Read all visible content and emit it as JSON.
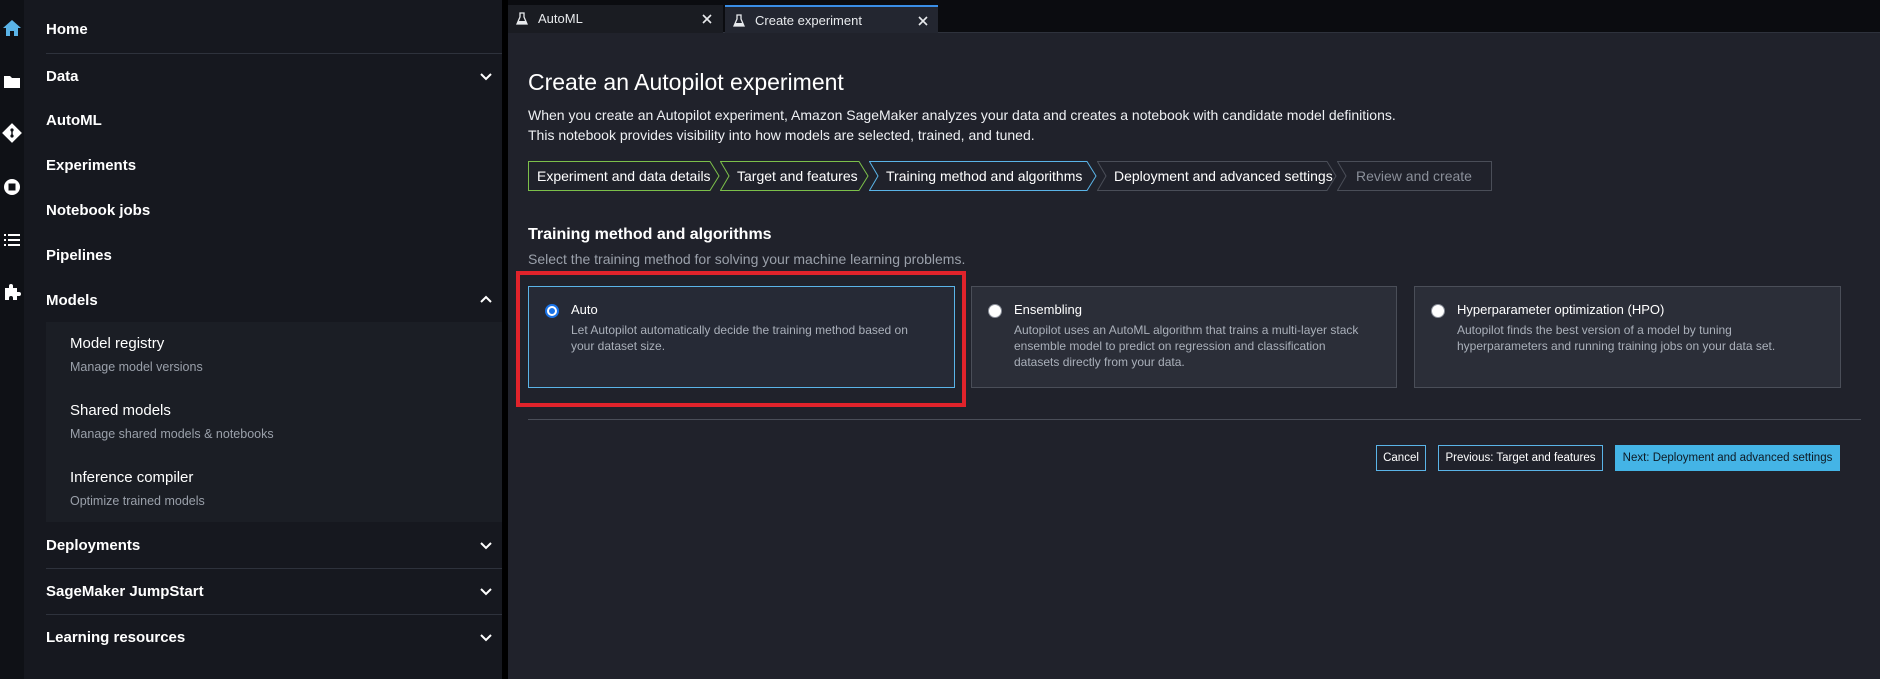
{
  "sidebar": {
    "home": "Home",
    "data": "Data",
    "automl": "AutoML",
    "experiments": "Experiments",
    "notebook_jobs": "Notebook jobs",
    "pipelines": "Pipelines",
    "models": "Models",
    "models_sub": [
      {
        "title": "Model registry",
        "desc": "Manage model versions"
      },
      {
        "title": "Shared models",
        "desc": "Manage shared models & notebooks"
      },
      {
        "title": "Inference compiler",
        "desc": "Optimize trained models"
      }
    ],
    "deployments": "Deployments",
    "jumpstart": "SageMaker JumpStart",
    "learning": "Learning resources"
  },
  "tabs": [
    {
      "label": "AutoML",
      "active": false
    },
    {
      "label": "Create experiment",
      "active": true
    }
  ],
  "page": {
    "title": "Create an Autopilot experiment",
    "desc_line1": "When you create an Autopilot experiment, Amazon SageMaker analyzes your data and creates a notebook with candidate model definitions.",
    "desc_line2": "This notebook provides visibility into how models are selected, trained, and tuned."
  },
  "steps": [
    {
      "label": "Experiment and data details",
      "state": "complete"
    },
    {
      "label": "Target and features",
      "state": "complete"
    },
    {
      "label": "Training method and algorithms",
      "state": "current"
    },
    {
      "label": "Deployment and advanced settings",
      "state": "upcoming"
    },
    {
      "label": "Review and create",
      "state": "disabled"
    }
  ],
  "section": {
    "title": "Training method and algorithms",
    "desc": "Select the training method for solving your machine learning problems."
  },
  "options": [
    {
      "title": "Auto",
      "desc1": "Let Autopilot automatically decide the training method based on",
      "desc2": "your dataset size.",
      "desc3": "",
      "selected": true
    },
    {
      "title": "Ensembling",
      "desc1": "Autopilot uses an AutoML algorithm that trains a multi-layer stack",
      "desc2": "ensemble model to predict on regression and classification",
      "desc3": "datasets directly from your data.",
      "selected": false
    },
    {
      "title": "Hyperparameter optimization (HPO)",
      "desc1": "Autopilot finds the best version of a model by tuning",
      "desc2": "hyperparameters and running training jobs on your data set.",
      "desc3": "",
      "selected": false
    }
  ],
  "buttons": {
    "cancel": "Cancel",
    "previous": "Previous: Target and features",
    "next": "Next: Deployment and advanced settings"
  },
  "colors": {
    "accent": "#44b4e6",
    "highlight": "#e0232b",
    "step_complete": "#7cc04a",
    "step_current": "#5ab4e8"
  }
}
